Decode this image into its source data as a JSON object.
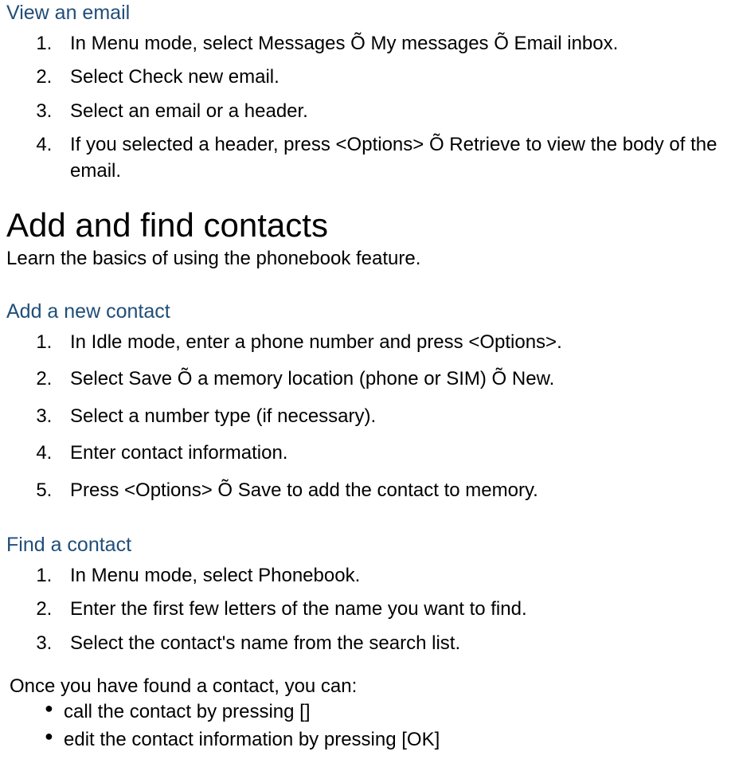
{
  "sections": {
    "viewEmail": {
      "title": "View an email",
      "steps": [
        "In Menu mode, select Messages Õ My messages Õ Email inbox.",
        "Select Check new email.",
        "Select an email or a header.",
        "If you selected a header, press <Options> Õ Retrieve to view the body of the email."
      ]
    },
    "contacts": {
      "title": "Add and find contacts",
      "intro": "Learn the basics of using the phonebook feature."
    },
    "addContact": {
      "title": "Add a new contact",
      "steps": [
        "In Idle mode, enter a phone number and press <Options>.",
        "Select Save Õ a memory location (phone or SIM) Õ New.",
        "Select a number type (if necessary).",
        "Enter contact information.",
        "Press <Options> Õ Save to add the contact to memory."
      ]
    },
    "findContact": {
      "title": "Find a contact",
      "steps": [
        "In Menu mode, select Phonebook.",
        "Enter the first few letters of the name you want to find.",
        "Select the contact's name from the search list."
      ],
      "afterFound": "Once you have found a contact, you can:",
      "actions": [
        "call the contact by pressing []",
        "edit the contact information by pressing [OK]"
      ]
    }
  }
}
